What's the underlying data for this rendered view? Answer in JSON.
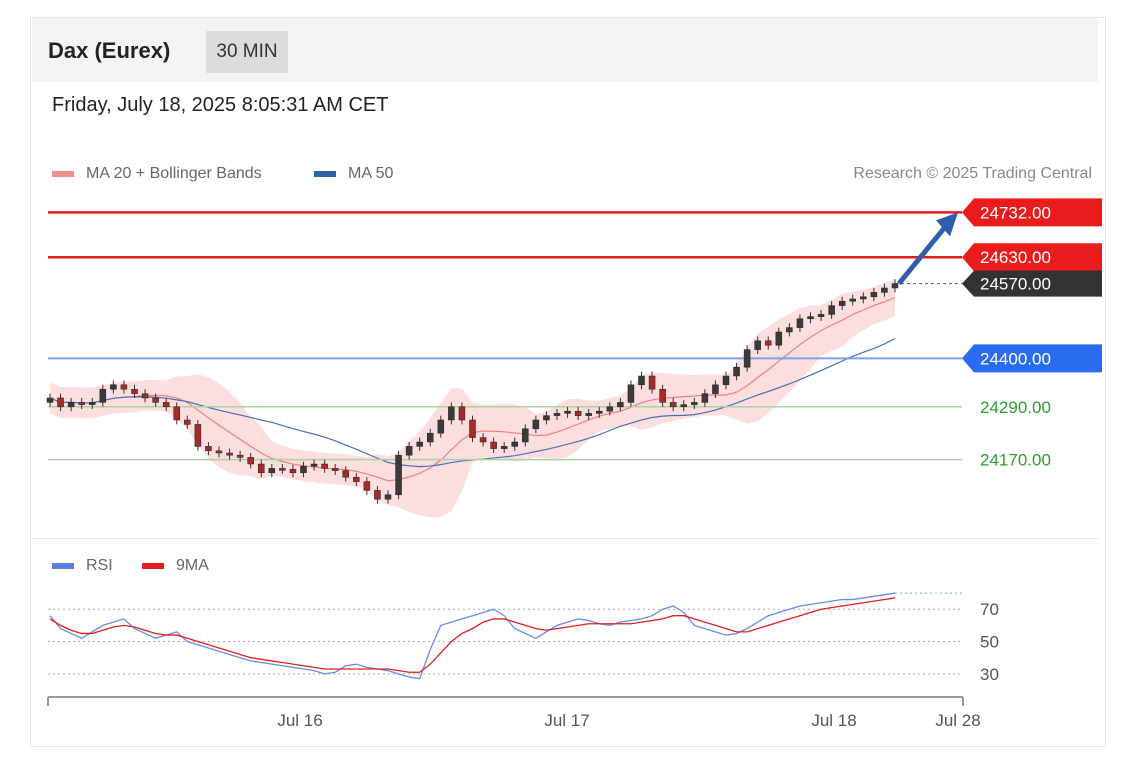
{
  "header": {
    "instrument": "Dax (Eurex)",
    "timeframe": "30 MIN"
  },
  "datetime": "Friday, July 18, 2025 8:05:31 AM CET",
  "legend": [
    {
      "label": "MA 20 + Bollinger Bands",
      "color": "#f08080"
    },
    {
      "label": "MA 50",
      "color": "#2e5fa8"
    }
  ],
  "credit": "Research © 2025 Trading Central",
  "rsi_legend": [
    {
      "label": "RSI",
      "color": "#5b7fe0"
    },
    {
      "label": "9MA",
      "color": "#e02020"
    }
  ],
  "chart_data": [
    {
      "type": "candlestick",
      "title": "",
      "series": [
        {
          "name": "Price",
          "values_close": [
            24310,
            24290,
            24300,
            24295,
            24300,
            24330,
            24340,
            24330,
            24320,
            24310,
            24300,
            24290,
            24260,
            24250,
            24200,
            24190,
            24185,
            24180,
            24175,
            24160,
            24140,
            24150,
            24148,
            24140,
            24155,
            24160,
            24150,
            24145,
            24130,
            24120,
            24100,
            24080,
            24090,
            24180,
            24200,
            24210,
            24230,
            24260,
            24290,
            24260,
            24220,
            24210,
            24195,
            24200,
            24210,
            24240,
            24260,
            24270,
            24275,
            24280,
            24270,
            24275,
            24280,
            24290,
            24300,
            24340,
            24360,
            24330,
            24300,
            24290,
            24295,
            24300,
            24320,
            24340,
            24360,
            24380,
            24420,
            24440,
            24430,
            24460,
            24470,
            24490,
            24495,
            24500,
            24520,
            24530,
            24535,
            24540,
            24550,
            24560,
            24570
          ]
        },
        {
          "name": "MA 20",
          "approx": "lags price"
        },
        {
          "name": "MA 50",
          "approx": "slow trend"
        }
      ],
      "levels": [
        {
          "value": "24732.00",
          "kind": "resistance",
          "color": "#e81c1c"
        },
        {
          "value": "24630.00",
          "kind": "resistance",
          "color": "#e81c1c"
        },
        {
          "value": "24570.00",
          "kind": "last",
          "color": "#333333"
        },
        {
          "value": "24400.00",
          "kind": "pivot",
          "color": "#2a6cf0"
        },
        {
          "value": "24290.00",
          "kind": "support",
          "color": "#2e9e2e"
        },
        {
          "value": "24170.00",
          "kind": "support",
          "color": "#2e9e2e"
        }
      ],
      "ylim": [
        24010,
        24760
      ]
    },
    {
      "type": "line",
      "title": "",
      "series": [
        {
          "name": "RSI",
          "values": [
            66,
            58,
            55,
            52,
            56,
            60,
            62,
            64,
            58,
            55,
            52,
            54,
            56,
            50,
            48,
            46,
            44,
            42,
            40,
            38,
            37,
            36,
            35,
            34,
            33,
            32,
            30,
            31,
            35,
            36,
            34,
            33,
            32,
            30,
            28,
            27,
            45,
            60,
            62,
            64,
            66,
            68,
            70,
            66,
            58,
            55,
            52,
            56,
            60,
            62,
            64,
            63,
            61,
            60,
            62,
            63,
            64,
            66,
            70,
            72,
            68,
            60,
            58,
            56,
            54,
            55,
            58,
            62,
            66,
            68,
            70,
            72,
            73,
            74,
            75,
            76,
            76,
            77,
            78,
            79,
            80
          ]
        },
        {
          "name": "9MA",
          "values": [
            64,
            60,
            57,
            55,
            55,
            57,
            59,
            60,
            59,
            57,
            55,
            54,
            54,
            52,
            50,
            48,
            46,
            44,
            42,
            40,
            39,
            38,
            37,
            36,
            35,
            34,
            33,
            33,
            33,
            33,
            33,
            33,
            33,
            32,
            31,
            31,
            36,
            43,
            50,
            55,
            58,
            62,
            64,
            64,
            62,
            60,
            58,
            57,
            58,
            59,
            60,
            61,
            61,
            61,
            61,
            61,
            62,
            63,
            64,
            66,
            66,
            64,
            62,
            60,
            58,
            56,
            56,
            58,
            60,
            62,
            64,
            66,
            68,
            70,
            71,
            72,
            73,
            74,
            75,
            76,
            77
          ]
        }
      ],
      "yticks": [
        "70",
        "50",
        "30"
      ],
      "xticks": [
        "Jul 16",
        "Jul 17",
        "Jul 18",
        "Jul 28"
      ],
      "ylim": [
        20,
        85
      ]
    }
  ]
}
